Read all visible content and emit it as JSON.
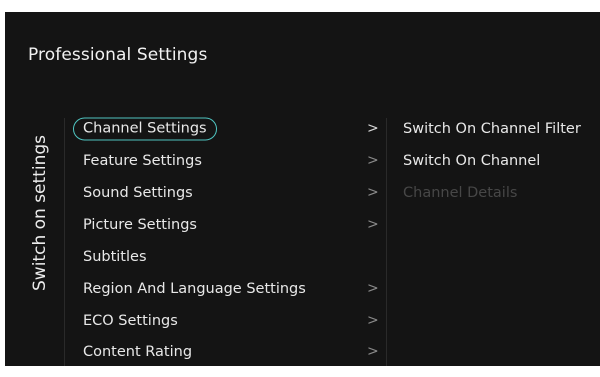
{
  "header": {
    "title": "Professional Settings"
  },
  "side_label": "Switch on settings",
  "menu": {
    "items": [
      {
        "label": "Channel Settings",
        "chevron": ">",
        "selected": true
      },
      {
        "label": "Feature Settings",
        "chevron": ">"
      },
      {
        "label": "Sound Settings",
        "chevron": ">"
      },
      {
        "label": "Picture Settings",
        "chevron": ">"
      },
      {
        "label": "Subtitles",
        "chevron": ""
      },
      {
        "label": "Region And Language Settings",
        "chevron": ">"
      },
      {
        "label": "ECO Settings",
        "chevron": ">"
      },
      {
        "label": "Content Rating",
        "chevron": ">"
      }
    ]
  },
  "submenu": {
    "items": [
      {
        "label": "Switch On Channel Filter",
        "enabled": true
      },
      {
        "label": "Switch On Channel",
        "enabled": true
      },
      {
        "label": "Channel Details",
        "enabled": false
      }
    ]
  },
  "colors": {
    "background": "#141414",
    "accent": "#4fc4c0",
    "text": "#e8e8e8",
    "disabled_text": "#474747"
  }
}
